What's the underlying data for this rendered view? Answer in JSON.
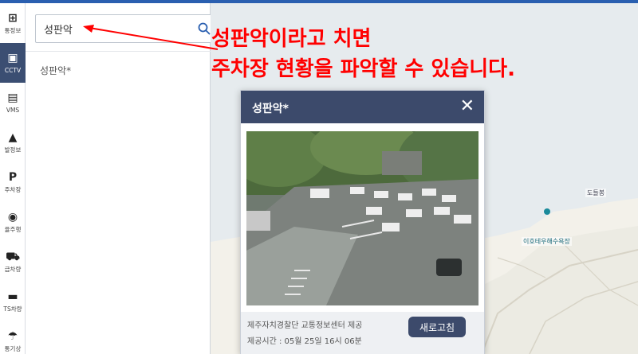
{
  "rail": {
    "items": [
      {
        "label": "통정보",
        "icon": "traffic-light-icon",
        "glyph": "⊞",
        "active": false
      },
      {
        "label": "CCTV",
        "icon": "cctv-icon",
        "glyph": "▣",
        "active": true
      },
      {
        "label": "VMS",
        "icon": "vms-sign-icon",
        "glyph": "▤",
        "active": false
      },
      {
        "label": "발정보",
        "icon": "warning-icon",
        "glyph": "▲",
        "active": false
      },
      {
        "label": "주차장",
        "icon": "parking-icon",
        "glyph": "P",
        "active": false
      },
      {
        "label": "율주행",
        "icon": "steering-wheel-icon",
        "glyph": "◉",
        "active": false
      },
      {
        "label": "급차량",
        "icon": "emergency-vehicle-icon",
        "glyph": "⛟",
        "active": false
      },
      {
        "label": "TS차량",
        "icon": "car-icon",
        "glyph": "▬",
        "active": false
      },
      {
        "label": "통기상",
        "icon": "weather-icon",
        "glyph": "☂",
        "active": false
      }
    ]
  },
  "search": {
    "value": "성판악",
    "result": "성판악*"
  },
  "annotation": {
    "line1": "성판악이라고 치면",
    "line2": "주차장 현황을 파악할 수 있습니다.",
    "color": "#ff0000"
  },
  "popup": {
    "title": "성판악*",
    "close": "✕",
    "source": "제주자치경찰단 교통정보센터 제공",
    "timestamp": "제공시간 : 05월 25일 16시 06분",
    "refresh_label": "새로고침"
  },
  "map": {
    "labels": [
      "도들봉",
      "이호테우해수욕장"
    ]
  },
  "colors": {
    "accent": "#3c4a6b",
    "topbar": "#2a5fb0"
  }
}
